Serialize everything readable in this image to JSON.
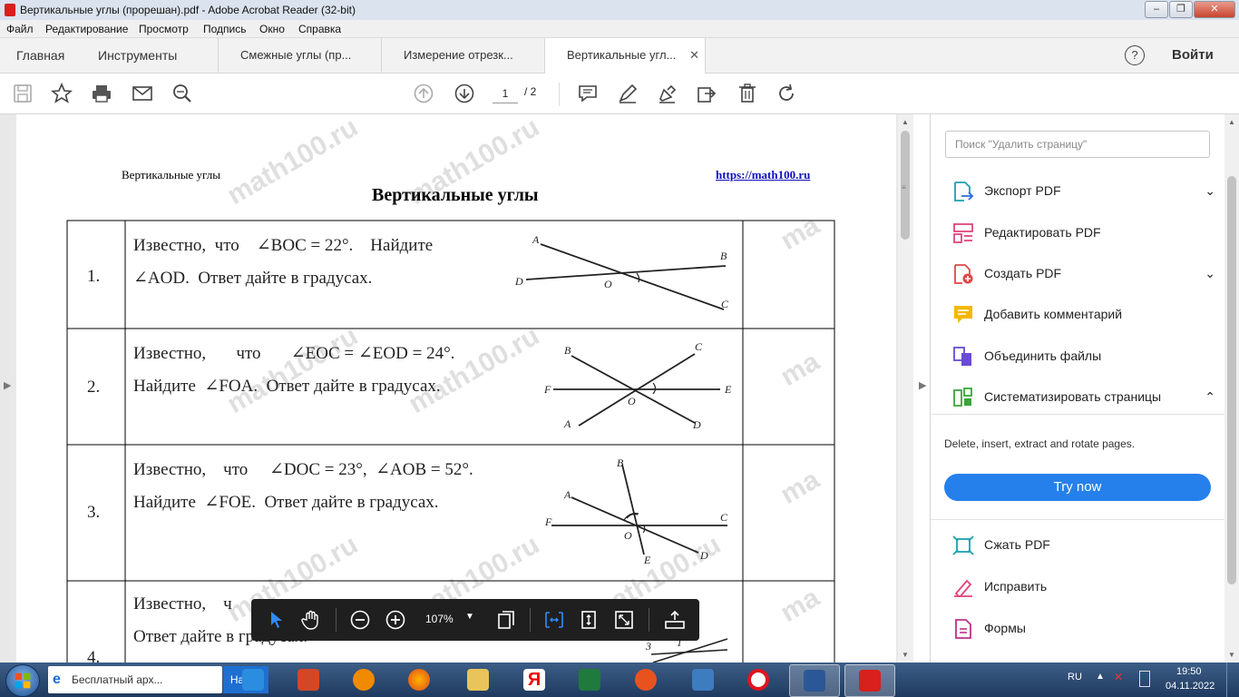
{
  "window": {
    "title": "Вертикальные углы (прорешан).pdf - Adobe Acrobat Reader (32-bit)"
  },
  "menu": [
    "Файл",
    "Редактирование",
    "Просмотр",
    "Подпись",
    "Окно",
    "Справка"
  ],
  "tabs": {
    "home": "Главная",
    "tools": "Инструменты",
    "docs": [
      "Смежные углы (пр...",
      "Измерение отрезк...",
      "Вертикальные угл..."
    ],
    "login": "Войти"
  },
  "toolbar": {
    "page_current": "1",
    "page_total": "/ 2"
  },
  "document": {
    "header_left": "Вертикальные углы",
    "header_right": "https://math100.ru",
    "title": "Вертикальные углы",
    "watermark": "math100.ru",
    "rows": [
      {
        "num": "1.",
        "line1": "Известно,  что    ∠BOC = 22°.    Найдите",
        "line2": "∠AOD.  Ответ дайте в градусах."
      },
      {
        "num": "2.",
        "line1": "Известно,       что       ∠EOC = ∠EOD = 24°.",
        "line2": "Найдите  ∠FOA.  Ответ дайте в градусах."
      },
      {
        "num": "3.",
        "line1": "Известно,    что     ∠DOC = 23°,  ∠AOB = 52°.",
        "line2": "Найдите  ∠FOE.  Ответ дайте в градусах."
      },
      {
        "num": "4.",
        "line1": "Известно,    ч",
        "line2": "Ответ дайте в градусах."
      }
    ]
  },
  "rightpane": {
    "search_placeholder": "Поиск \"Удалить страницу\"",
    "tools": [
      "Экспорт PDF",
      "Редактировать PDF",
      "Создать PDF",
      "Добавить комментарий",
      "Объединить файлы",
      "Систематизировать страницы"
    ],
    "desc": "Delete, insert, extract and rotate pages.",
    "try_now": "Try now",
    "tools2": [
      "Сжать PDF",
      "Исправить",
      "Формы"
    ]
  },
  "floatbar": {
    "zoom": "107%"
  },
  "taskbar": {
    "task_label": "Бесплатный арх...",
    "task_action": "Найти",
    "lang": "RU",
    "time": "19:50",
    "date": "04.11.2022"
  },
  "colors": {
    "accent": "#2680eb",
    "pdf_red": "#d8201c"
  },
  "icons": [
    "save-icon",
    "bookmark-star-icon",
    "print-icon",
    "mail-icon",
    "zoom-icon",
    "page-up-icon",
    "page-down-icon",
    "comment-icon",
    "highlight-icon",
    "sign-icon",
    "export-icon",
    "delete-icon",
    "rotate-icon",
    "help-icon"
  ]
}
